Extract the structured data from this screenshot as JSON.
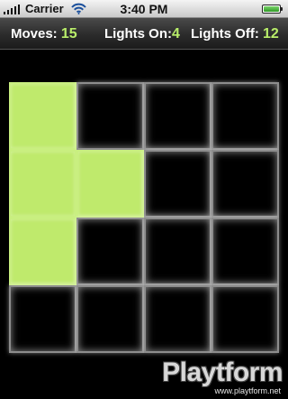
{
  "status_bar": {
    "carrier": "Carrier",
    "time": "3:40 PM",
    "signal_icon": "signal-bars",
    "wifi_icon": "wifi",
    "battery_icon": "battery-full"
  },
  "stats": {
    "moves_label": "Moves:",
    "moves_value": "15",
    "lights_on_label": "Lights On:",
    "lights_on_value": "4",
    "lights_off_label": "Lights Off:",
    "lights_off_value": "12"
  },
  "board": {
    "rows": 4,
    "columns": 4,
    "cells": [
      [
        1,
        0,
        0,
        0
      ],
      [
        1,
        1,
        0,
        0
      ],
      [
        1,
        0,
        0,
        0
      ],
      [
        0,
        0,
        0,
        0
      ]
    ],
    "on_color": "#bfea6c",
    "off_color": "#000000",
    "accent_color": "#b9ee6a"
  },
  "watermark": {
    "logo_text": "Playtform",
    "url": "www.playtform.net"
  }
}
